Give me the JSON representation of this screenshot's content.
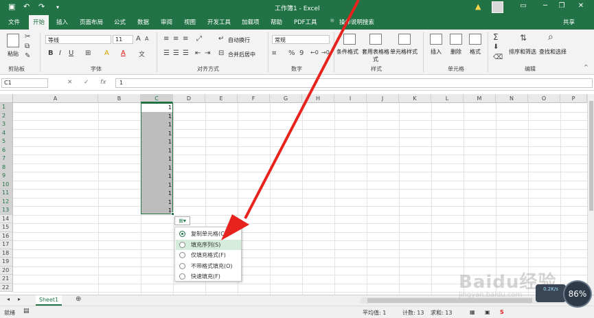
{
  "window": {
    "title": "工作簿1 - Excel",
    "account": "共享"
  },
  "tabs": [
    "文件",
    "开始",
    "插入",
    "页面布局",
    "公式",
    "数据",
    "审阅",
    "视图",
    "开发工具",
    "加载项",
    "帮助",
    "PDF工具",
    "操作说明搜索"
  ],
  "active_tab": "开始",
  "ribbon": {
    "groups": {
      "clipboard": "剪贴板",
      "font": "字体",
      "alignment": "对齐方式",
      "number": "数字",
      "styles": "样式",
      "cells": "单元格",
      "editing": "编辑"
    },
    "paste": "粘贴",
    "font_name": "等线",
    "font_size": "11",
    "wrap_text": "自动换行",
    "merge_center": "合并后居中",
    "number_format": "常规",
    "conditional_format": "条件格式",
    "format_as_table": "套用表格格式",
    "cell_styles": "单元格样式",
    "insert": "插入",
    "delete": "删除",
    "format": "格式",
    "sort_filter": "排序和筛选",
    "find_select": "查找和选择",
    "bold": "B",
    "italic": "I",
    "underline": "U",
    "font_grow": "A",
    "font_shrink": "A",
    "percent": "%",
    "comma": "9",
    "sum": "Σ",
    "font_color": "A",
    "fill_color": "A"
  },
  "formula_bar": {
    "name_box": "C1",
    "value": "1",
    "fx": "fx"
  },
  "columns": [
    "A",
    "B",
    "C",
    "D",
    "E",
    "F",
    "G",
    "H",
    "I",
    "J",
    "K",
    "L",
    "M",
    "N",
    "O",
    "P"
  ],
  "rows": [
    "1",
    "2",
    "3",
    "4",
    "5",
    "6",
    "7",
    "8",
    "9",
    "10",
    "11",
    "12",
    "13",
    "14",
    "15",
    "16",
    "17",
    "18",
    "19",
    "20",
    "21",
    "22"
  ],
  "selected_column": "C",
  "cells_c": [
    "1",
    "1",
    "1",
    "1",
    "1",
    "1",
    "1",
    "1",
    "1",
    "1",
    "1",
    "1",
    "1"
  ],
  "autofill_menu": {
    "items": [
      "复制单元格(C)",
      "填充序列(S)",
      "仅填充格式(F)",
      "不带格式填充(O)",
      "快速填充(F)"
    ],
    "selected_index": 0,
    "hover_index": 1
  },
  "sheets": [
    "Sheet1"
  ],
  "status": {
    "mode": "就绪",
    "average": "平均值: 1",
    "count": "计数: 13",
    "sum": "求和: 13"
  },
  "overlay": {
    "speed_badge": "86%",
    "speed_text": "0.2K/s",
    "watermark": "Baidu经验",
    "watermark_url": "jingyan.baidu.com"
  },
  "colors": {
    "brand_green": "#217346",
    "annotation_red": "#e8221c"
  }
}
